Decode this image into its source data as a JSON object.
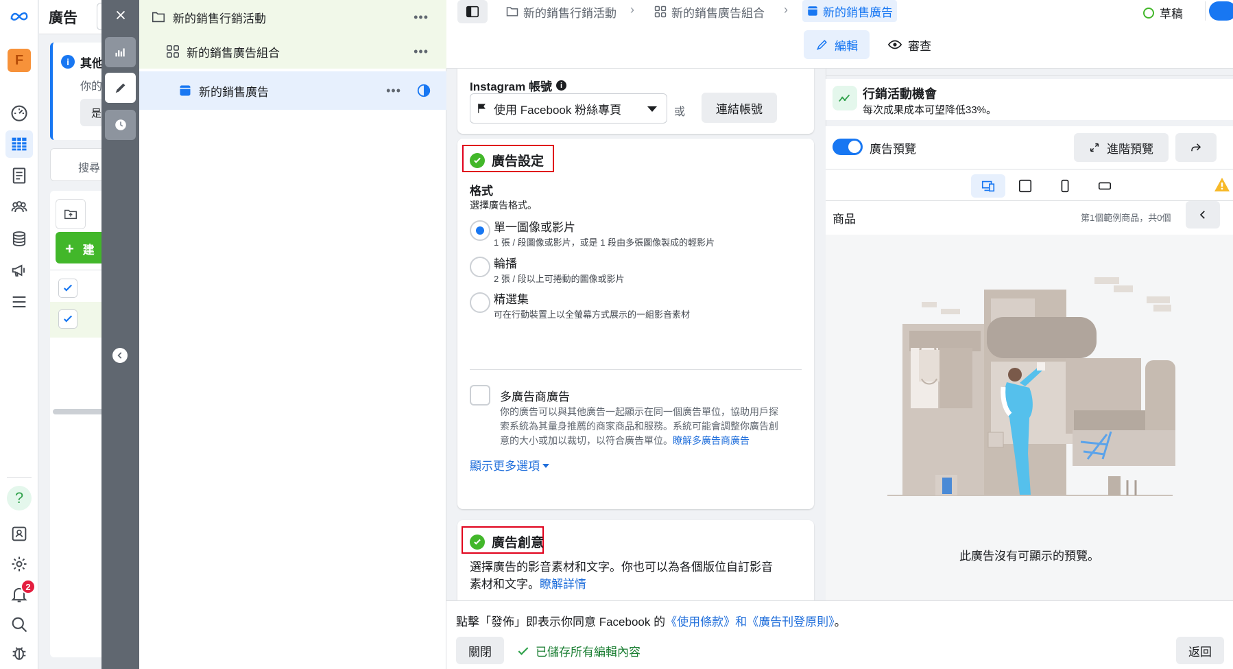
{
  "rail": {
    "avatar_letter": "F",
    "notification_count": "2"
  },
  "adspanel": {
    "title": "廣告",
    "info_title": "其他",
    "info_text": "你的",
    "info_btn": "是",
    "search_placeholder": "搜尋",
    "create_label": "建"
  },
  "tree": {
    "campaign": "新的銷售行銷活動",
    "adset": "新的銷售廣告組合",
    "ad": "新的銷售廣告",
    "more": "•••"
  },
  "topbar": {
    "crumb_campaign": "新的銷售行銷活動",
    "crumb_adset": "新的銷售廣告組合",
    "crumb_ad": "新的銷售廣告",
    "status": "草稿",
    "tab_edit": "編輯",
    "tab_review": "審查"
  },
  "form": {
    "instagram_label": "Instagram 帳號",
    "instagram_select": "使用 Facebook 粉絲專頁",
    "or": "或",
    "connect_btn": "連結帳號",
    "ad_setup_title": "廣告設定",
    "format_label": "格式",
    "format_sub": "選擇廣告格式。",
    "formats": [
      {
        "title": "單一圖像或影片",
        "desc": "1 張 / 段圖像或影片，或是 1 段由多張圖像製成的輕影片",
        "selected": true
      },
      {
        "title": "輪播",
        "desc": "2 張 / 段以上可捲動的圖像或影片",
        "selected": false
      },
      {
        "title": "精選集",
        "desc": "可在行動裝置上以全螢幕方式展示的一組影音素材",
        "selected": false
      }
    ],
    "multi_title": "多廣告商廣告",
    "multi_desc_1": "你的廣告可以與其他廣告一起顯示在同一個廣告單位，協助用戶探",
    "multi_desc_2": "索系統為其量身推薦的商家商品和服務。系統可能會調整你廣告創",
    "multi_desc_3": "意的大小或加以裁切，以符合廣告單位。",
    "multi_link": "瞭解多廣告商廣告",
    "show_more": "顯示更多選項",
    "creative_title": "廣告創意",
    "creative_desc_1": "選擇廣告的影音素材和文字。你也可以為各個版位自訂影音",
    "creative_desc_2": "素材和文字。",
    "creative_link": "瞭解詳情"
  },
  "preview": {
    "opp_title": "行銷活動機會",
    "opp_desc": "每次成果成本可望降低33%。",
    "toggle_label": "廣告預覽",
    "advanced_btn": "進階預覽",
    "product_label": "商品",
    "product_count": "第1個範例商品，共0個",
    "no_preview": "此廣告沒有可顯示的預覽。"
  },
  "footer": {
    "terms_prefix": "點擊「發佈」即表示你同意 Facebook 的",
    "terms_link": "《使用條款》和《廣告刊登原則》",
    "terms_suffix": "。",
    "close_btn": "關閉",
    "saved": "已儲存所有編輯內容",
    "back_btn": "返回"
  },
  "colors": {
    "brand_blue": "#1877f2",
    "success_green": "#42b72a",
    "highlight_red": "#e0001b",
    "tree_campaign_bg": "#f1f8e9",
    "tree_selected_bg": "#e7f0fd"
  }
}
